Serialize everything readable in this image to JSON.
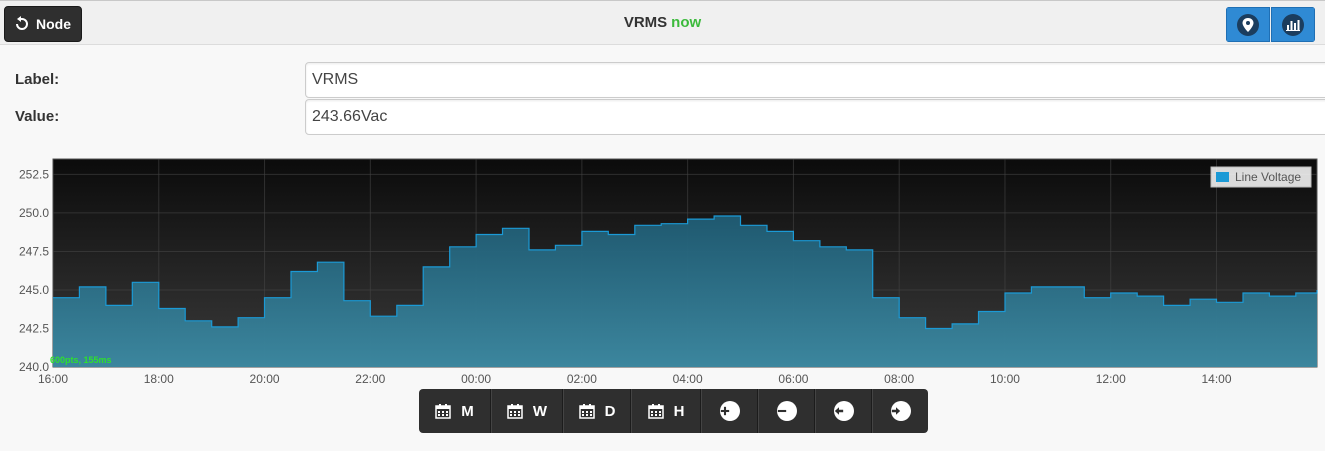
{
  "header": {
    "back_label": "Node",
    "title": "VRMS",
    "status": "now"
  },
  "fields": {
    "label_caption": "Label:",
    "label_value": "VRMS",
    "value_caption": "Value:",
    "value_value": "243.66Vac"
  },
  "range_buttons": {
    "month": "M",
    "week": "W",
    "day": "D",
    "hour": "H"
  },
  "chart_info": "600pts, 155ms",
  "colors": {
    "accent_blue": "#2f8ad4",
    "series_line": "#1b9ad6",
    "status_green": "#3cba3c",
    "chart_bg_top": "#0b0b0b",
    "chart_bg_bottom": "#3a3a3a"
  },
  "chart_data": {
    "type": "area",
    "legend": "Line Voltage",
    "legend_position": "top-right",
    "xlabel": "",
    "ylabel": "",
    "ylim": [
      240.0,
      253.5
    ],
    "xlim": [
      0,
      23.9
    ],
    "yticks": [
      240.0,
      242.5,
      245.0,
      247.5,
      250.0,
      252.5
    ],
    "ytick_labels": [
      "240.0",
      "242.5",
      "245.0",
      "247.5",
      "250.0",
      "252.5"
    ],
    "xticks": [
      0,
      2,
      4,
      6,
      8,
      10,
      12,
      14,
      16,
      18,
      20,
      22
    ],
    "xtick_labels": [
      "16:00",
      "18:00",
      "20:00",
      "22:00",
      "00:00",
      "02:00",
      "04:00",
      "06:00",
      "08:00",
      "10:00",
      "12:00",
      "14:00"
    ],
    "grid": true,
    "series": [
      {
        "name": "Line Voltage",
        "x": [
          0,
          0.5,
          1,
          1.5,
          2,
          2.5,
          3,
          3.5,
          4,
          4.5,
          5,
          5.5,
          6,
          6.5,
          7,
          7.5,
          8,
          8.5,
          9,
          9.5,
          10,
          10.5,
          11,
          11.5,
          12,
          12.5,
          13,
          13.5,
          14,
          14.5,
          15,
          15.5,
          16,
          16.5,
          17,
          17.5,
          18,
          18.5,
          19,
          19.5,
          20,
          20.5,
          21,
          21.5,
          22,
          22.5,
          23,
          23.5,
          23.9
        ],
        "y": [
          244.5,
          245.2,
          244.0,
          245.5,
          243.8,
          243.0,
          242.6,
          243.2,
          244.5,
          246.2,
          246.8,
          244.3,
          243.3,
          244.0,
          246.5,
          247.8,
          248.6,
          249.0,
          247.6,
          247.9,
          248.8,
          248.6,
          249.2,
          249.3,
          249.6,
          249.8,
          249.2,
          248.8,
          248.2,
          247.8,
          247.6,
          244.5,
          243.2,
          242.5,
          242.8,
          243.6,
          244.8,
          245.2,
          245.2,
          244.5,
          244.8,
          244.6,
          244.0,
          244.4,
          244.2,
          244.8,
          244.6,
          244.8,
          245.0
        ]
      }
    ]
  }
}
